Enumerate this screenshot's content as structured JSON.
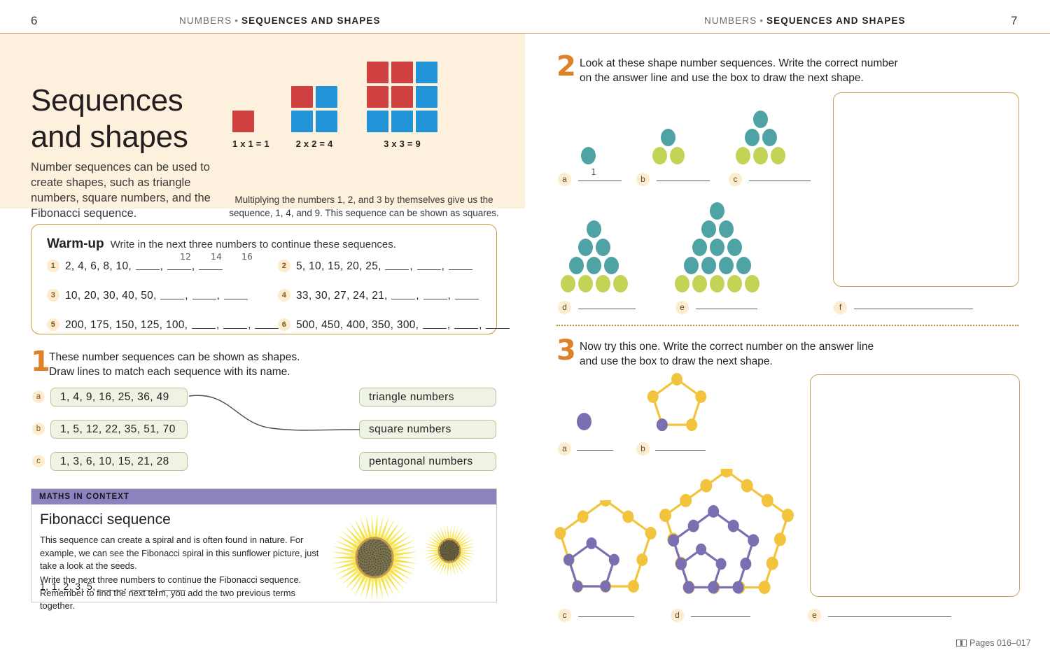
{
  "left_page": {
    "folio": "6",
    "runhead_soft": "NUMBERS",
    "runhead_sep": "•",
    "runhead_strong": "SEQUENCES AND SHAPES",
    "hero": {
      "title_line1": "Sequences",
      "title_line2": "and shapes",
      "body": "Number sequences can be used to create shapes, such as triangle numbers, square numbers, and the Fibonacci sequence.",
      "caption": "Multiplying the numbers 1, 2, and 3 by themselves give us the sequence, 1, 4, and 9. This sequence can be shown as squares.",
      "squares": [
        {
          "label": "1 x 1 = 1",
          "cols": 1,
          "cells": [
            "red"
          ]
        },
        {
          "label": "2 x 2 = 4",
          "cols": 2,
          "cells": [
            "red",
            "blue",
            "blue",
            "blue"
          ]
        },
        {
          "label": "3 x 3 = 9",
          "cols": 3,
          "cells": [
            "red",
            "red",
            "blue",
            "red",
            "red",
            "blue",
            "blue",
            "blue",
            "blue"
          ]
        }
      ]
    },
    "warmup": {
      "title": "Warm-up",
      "instruction": "Write in the next three numbers to continue these sequences.",
      "items": [
        {
          "n": "1",
          "seq": "2,  4,  6,  8,  10,",
          "blanks": 3,
          "answers": [
            "12",
            "14",
            "16"
          ]
        },
        {
          "n": "2",
          "seq": "5,  10,  15,  20,  25,",
          "blanks": 3,
          "answers": []
        },
        {
          "n": "3",
          "seq": "10,  20,  30,  40,  50,",
          "blanks": 3,
          "answers": []
        },
        {
          "n": "4",
          "seq": "33,  30,  27,  24,  21,",
          "blanks": 3,
          "answers": []
        },
        {
          "n": "5",
          "seq": "200,  175,  150,  125,  100,",
          "blanks": 3,
          "answers": []
        },
        {
          "n": "6",
          "seq": "500,  450,  400,  350,  300,",
          "blanks": 3,
          "answers": []
        }
      ]
    },
    "exercise1": {
      "number": "1",
      "text_line1": "These number sequences can be shown as shapes.",
      "text_line2": "Draw lines to match each sequence with its name.",
      "sequences": [
        {
          "letter": "a",
          "value": "1,  4,  9,  16,  25,  36,  49"
        },
        {
          "letter": "b",
          "value": "1,  5,  12,  22,  35,  51,  70"
        },
        {
          "letter": "c",
          "value": "1,  3,  6,  10,  15,  21,  28"
        }
      ],
      "names": [
        "triangle numbers",
        "square numbers",
        "pentagonal numbers"
      ],
      "drawn_match": "a-to-square numbers"
    },
    "maths_in_context": {
      "banner": "MATHS IN CONTEXT",
      "title": "Fibonacci sequence",
      "para1": "This sequence can create a spiral and is often found in nature. For example, we can see the Fibonacci spiral in this sunflower picture, just take a look at the seeds.",
      "para2": "Write the next three numbers to continue the Fibonacci sequence. Remember to find the next term, you add the two previous terms together.",
      "sequence": "1,  1,  2,  3,  5,",
      "blanks": 3
    }
  },
  "right_page": {
    "folio": "7",
    "runhead_soft": "NUMBERS",
    "runhead_sep": "•",
    "runhead_strong": "SEQUENCES AND SHAPES",
    "exercise2": {
      "number": "2",
      "text_line1": "Look at these shape number sequences. Write the correct number",
      "text_line2": "on the answer line and use the box to draw the next shape.",
      "items": [
        {
          "letter": "a",
          "rows": 1,
          "answer": "1"
        },
        {
          "letter": "b",
          "rows": 2,
          "answer": ""
        },
        {
          "letter": "c",
          "rows": 3,
          "answer": ""
        },
        {
          "letter": "d",
          "rows": 4,
          "answer": ""
        },
        {
          "letter": "e",
          "rows": 5,
          "answer": ""
        },
        {
          "letter": "f",
          "rows": 0,
          "answer": ""
        }
      ]
    },
    "exercise3": {
      "number": "3",
      "text_line1": "Now try this one. Write the correct number on the answer line",
      "text_line2": "and use the box to draw the next shape.",
      "items": [
        {
          "letter": "a",
          "stage": 1,
          "answer": ""
        },
        {
          "letter": "b",
          "stage": 2,
          "answer": ""
        },
        {
          "letter": "c",
          "stage": 3,
          "answer": ""
        },
        {
          "letter": "d",
          "stage": 4,
          "answer": ""
        },
        {
          "letter": "e",
          "stage": 0,
          "answer": ""
        }
      ]
    },
    "footer": {
      "icon": "open-book-icon",
      "text": "Pages 016–017"
    }
  },
  "colors": {
    "hero_bg": "#fdf1dd",
    "accent_orange": "#dd8227",
    "rule_gold": "#c4a15a",
    "square_red": "#cf4040",
    "square_blue": "#2193d6",
    "dot_teal": "#4fa3a5",
    "dot_lime": "#c3d355",
    "dot_purple": "#7a6fb0",
    "pent_yellow": "#f2c33c",
    "mic_banner": "#8b83bd",
    "match_box_bg": "#eef3e3"
  }
}
